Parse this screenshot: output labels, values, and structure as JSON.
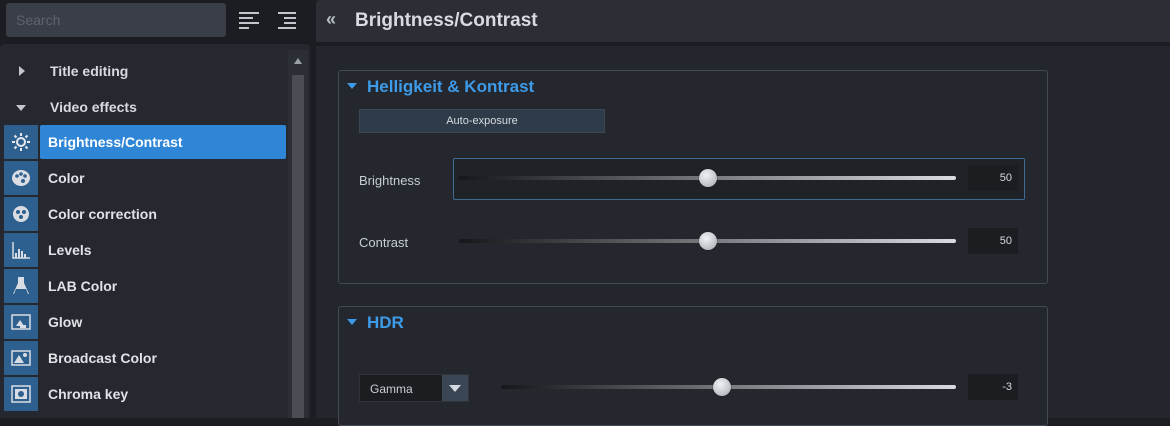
{
  "search": {
    "placeholder": "Search"
  },
  "tree": {
    "groups": [
      {
        "label": "Title editing",
        "expanded": false
      },
      {
        "label": "Video effects",
        "expanded": true
      }
    ],
    "effects": [
      {
        "label": "Brightness/Contrast",
        "icon": "brightness-icon",
        "selected": true
      },
      {
        "label": "Color",
        "icon": "palette-icon",
        "selected": false
      },
      {
        "label": "Color correction",
        "icon": "color-correction-icon",
        "selected": false
      },
      {
        "label": "Levels",
        "icon": "levels-icon",
        "selected": false
      },
      {
        "label": "LAB Color",
        "icon": "flask-icon",
        "selected": false
      },
      {
        "label": "Glow",
        "icon": "glow-icon",
        "selected": false
      },
      {
        "label": "Broadcast Color",
        "icon": "broadcast-color-icon",
        "selected": false
      },
      {
        "label": "Chroma key",
        "icon": "chroma-key-icon",
        "selected": false
      }
    ]
  },
  "header": {
    "back": "«",
    "title": "Brightness/Contrast"
  },
  "panel1": {
    "title": "Helligkeit & Kontrast",
    "auto_button": "Auto-exposure",
    "brightness": {
      "label": "Brightness",
      "value": "50"
    },
    "contrast": {
      "label": "Contrast",
      "value": "50"
    }
  },
  "panel2": {
    "title": "HDR",
    "mode": "Gamma",
    "value": "-3"
  },
  "colors": {
    "accent": "#2f86d6",
    "heading": "#3d9be9",
    "icon_bg": "#2d5f8f"
  }
}
